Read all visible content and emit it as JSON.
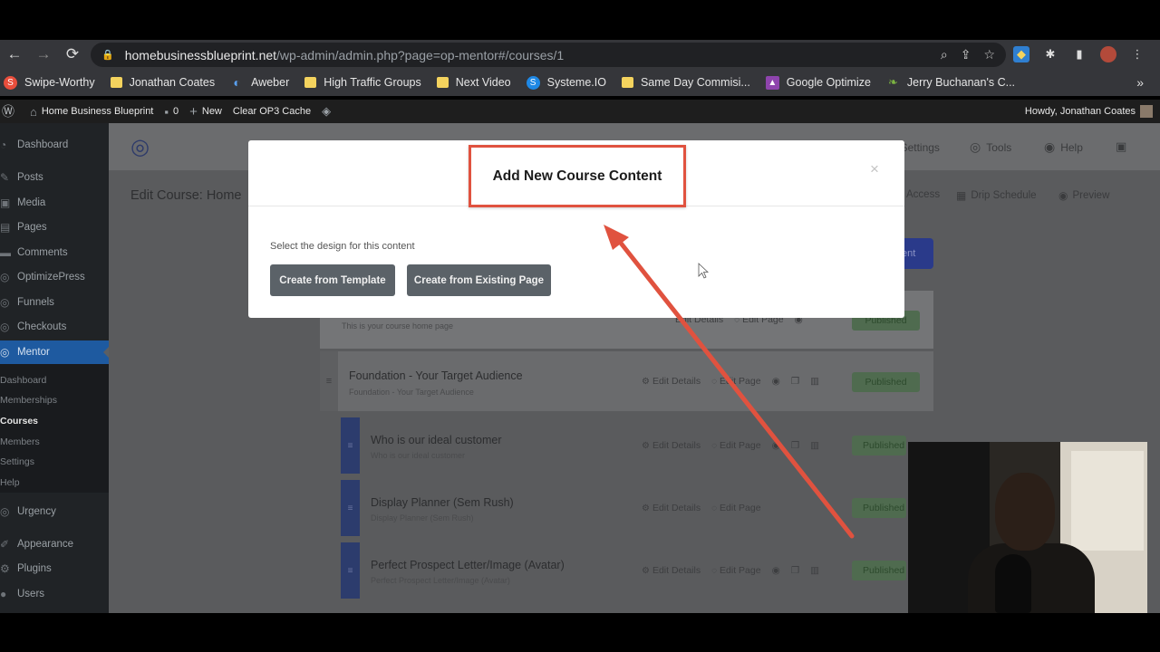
{
  "browser": {
    "url_host": "homebusinessblueprint.net",
    "url_path": "/wp-admin/admin.php?page=op-mentor#/courses/1",
    "bookmarks": [
      {
        "label": "Swipe-Worthy",
        "icon": "s-badge-icon",
        "color": "#e94e3c"
      },
      {
        "label": "Jonathan Coates",
        "icon": "folder-icon"
      },
      {
        "label": "Aweber",
        "icon": "aweber-icon",
        "color": "#2a6fd6"
      },
      {
        "label": "High Traffic Groups",
        "icon": "folder-icon"
      },
      {
        "label": "Next Video",
        "icon": "folder-icon"
      },
      {
        "label": "Systeme.IO",
        "icon": "s-badge-icon",
        "color": "#1e88e5"
      },
      {
        "label": "Same Day Commisi...",
        "icon": "folder-icon"
      },
      {
        "label": "Google Optimize",
        "icon": "optimize-icon",
        "color": "#8e44ad"
      },
      {
        "label": "Jerry Buchanan's C...",
        "icon": "leaf-icon",
        "color": "#7cb342"
      }
    ]
  },
  "adminbar": {
    "site_name": "Home Business Blueprint",
    "comments_count": "0",
    "new_label": "New",
    "clear_cache_label": "Clear OP3 Cache",
    "howdy": "Howdy, Jonathan Coates"
  },
  "sidebar": {
    "items": [
      "Dashboard",
      "Posts",
      "Media",
      "Pages",
      "Comments",
      "OptimizePress",
      "Funnels",
      "Checkouts",
      "Mentor",
      "Urgency",
      "Appearance",
      "Plugins",
      "Users"
    ],
    "submenu": [
      "Dashboard",
      "Memberships",
      "Courses",
      "Members",
      "Settings",
      "Help"
    ]
  },
  "main": {
    "top_links": {
      "settings": "Settings",
      "tools": "Tools",
      "help": "Help"
    },
    "page_title": "Edit Course: Home",
    "sub_links": {
      "access": "Access",
      "drip": "Drip Schedule",
      "preview": "Preview"
    },
    "add_btn_partial": "tent",
    "first_row_subtitle": "This is your course home page",
    "action_labels": {
      "edit_details": "Edit Details",
      "edit_page": "Edit Page"
    },
    "status_label": "Published",
    "rows": [
      {
        "title": "Foundation - Your Target Audience",
        "subtitle": "Foundation - Your Target Audience"
      },
      {
        "title": "Who is our ideal customer",
        "subtitle": "Who is our ideal customer"
      },
      {
        "title": "Display Planner (Sem Rush)",
        "subtitle": "Display Planner (Sem Rush)"
      },
      {
        "title": "Perfect Prospect Letter/Image (Avatar)",
        "subtitle": "Perfect Prospect Letter/Image (Avatar)"
      }
    ]
  },
  "modal": {
    "title": "Add New Course Content",
    "close": "×",
    "label": "Select the design for this content",
    "btn_template": "Create from Template",
    "btn_existing": "Create from Existing Page"
  },
  "colors": {
    "annotation_red": "#e0523f",
    "mentor_active": "#1e5aa0",
    "modal_button": "#5b6268"
  }
}
